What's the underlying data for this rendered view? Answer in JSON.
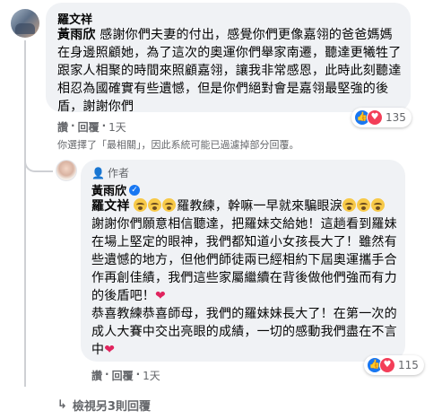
{
  "comment1": {
    "author": "羅文祥",
    "mention": "黃雨欣",
    "text": " 感謝你們夫妻的付出，感覺你們更像嘉翎的爸爸媽媽在身邊照顧她，為了這次的奧運你們舉家南遷，聽達更犧牲了跟家人相聚的時間來照顧嘉翎，讓我非常感恩，此時此刻聽達相忍為國確實有些遺憾，但是你們絕對會是嘉翎最堅強的後盾，謝謝你們",
    "like_label": "讚",
    "reply_label": "回覆",
    "time": "1天",
    "reaction_count": "135"
  },
  "filter_note": "你選擇了「最相關」，因此系統可能已過濾掉部分回覆。",
  "reply1": {
    "badge": "作者",
    "author": "黃雨欣",
    "mention": "羅文祥",
    "text_after_mention": "羅教練，幹嘛一早就來騙眼淚",
    "text_p2": "謝謝你們願意相信聽達，把羅妹交給她！這趟看到羅妹在場上堅定的眼神，我們都知道小女孩長大了！雖然有些遺憾的地方，但他們師徒兩已經相約下屆奧運攜手合作再創佳績，我們這些家屬繼續在背後做他們強而有力的後盾吧！",
    "text_p3": "恭喜教練恭喜師母，我們的羅妹妹長大了！在第一次的成人大賽中交出亮眼的成績，一切的感動我們盡在不言中",
    "like_label": "讚",
    "reply_label": "回覆",
    "time": "1天",
    "reaction_count": "115"
  },
  "more_replies": "檢視另3則回覆",
  "colors": {
    "accent": "#1877f2",
    "heart": "#f33e58",
    "bubble": "#f0f2f5",
    "muted": "#65676b"
  },
  "icons": [
    "like-icon",
    "heart-icon",
    "verified-icon",
    "reply-arrow-icon",
    "crying-emoji-icon",
    "red-heart-icon",
    "person-icon"
  ]
}
